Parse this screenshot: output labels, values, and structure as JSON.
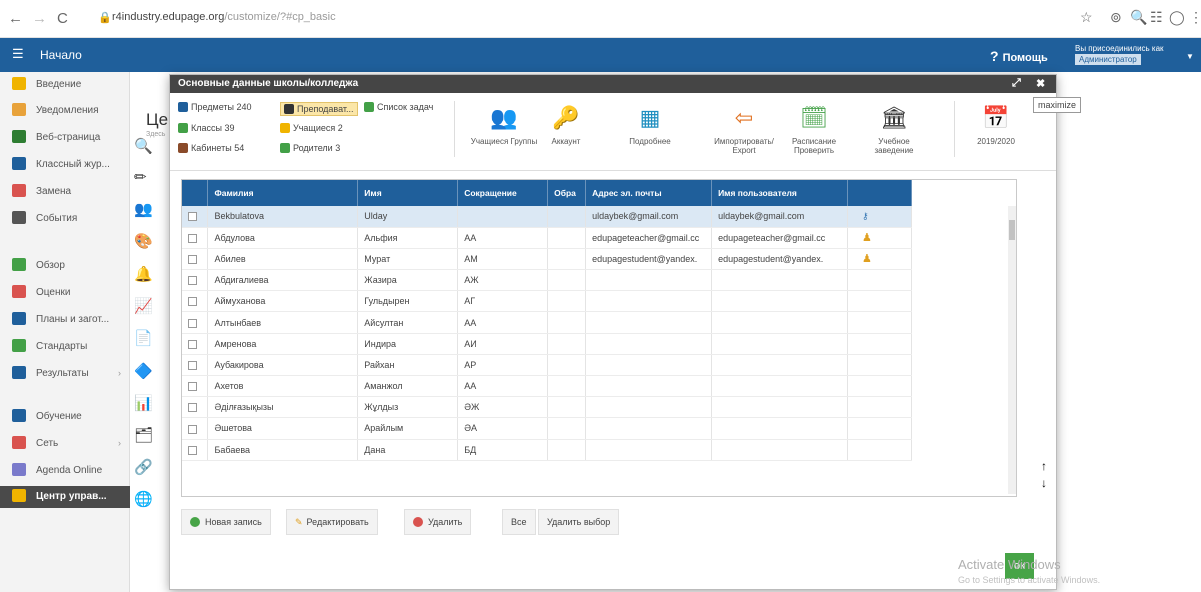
{
  "browser": {
    "url_host": "r4industry.edupage.org",
    "url_path": "/customize/?#cp_basic"
  },
  "header": {
    "home": "Начало",
    "help": "Помощь",
    "user_line": "Вы присоединились как",
    "user_role": "Администратор"
  },
  "sidebar": {
    "items": [
      {
        "label": "Введение",
        "color": "#f0b400"
      },
      {
        "label": "Уведомления",
        "color": "#e8a23a"
      },
      {
        "label": "Веб-страница",
        "color": "#2e7d32"
      },
      {
        "label": "Классный жур...",
        "color": "#1f5f9b"
      },
      {
        "label": "Замена",
        "color": "#d9534f"
      },
      {
        "label": "События",
        "color": "#555555"
      },
      {
        "label": "Обзор",
        "color": "#43a047"
      },
      {
        "label": "Оценки",
        "color": "#d9534f"
      },
      {
        "label": "Планы и загот...",
        "color": "#1f5f9b"
      },
      {
        "label": "Стандарты",
        "color": "#43a047"
      },
      {
        "label": "Результаты",
        "color": "#1f5f9b"
      },
      {
        "label": "Обучение",
        "color": "#1f5f9b"
      },
      {
        "label": "Сеть",
        "color": "#d9534f"
      },
      {
        "label": "Agenda Online",
        "color": "#7a7acb"
      },
      {
        "label": "Центр управ...",
        "color": "#f0b400"
      }
    ]
  },
  "background": {
    "title": "Цен",
    "subtitle": "Здесь"
  },
  "dialog": {
    "title": "Основные данные школы/колледжа",
    "quick_links": [
      {
        "label": "Предметы 240",
        "color": "#1f5f9b"
      },
      {
        "label": "Преподават...",
        "color": "#333333"
      },
      {
        "label": "Список задач",
        "color": "#43a047"
      },
      {
        "label": "Классы 39",
        "color": "#43a047"
      },
      {
        "label": "Учащиеся 2",
        "color": "#f0b400"
      },
      {
        "label": "Кабинеты 54",
        "color": "#8a4b2a"
      },
      {
        "label": "Родители 3",
        "color": "#43a047"
      }
    ],
    "toolbar_buttons": [
      {
        "label": "Учащиеся Группы",
        "icon": "👥"
      },
      {
        "label": "Аккаунт",
        "icon": "🔑"
      },
      {
        "label": "Подробнее",
        "icon": "▦"
      },
      {
        "label": "Импортировать/ Export",
        "icon": "⇦"
      },
      {
        "label": "Расписание Проверить",
        "icon": "🗓"
      },
      {
        "label": "Учебное заведение",
        "icon": "🏛"
      },
      {
        "label": "2019/2020",
        "icon": "📅"
      }
    ],
    "columns": [
      "Фамилия",
      "Имя",
      "Сокращение",
      "Обра",
      "Адрес эл. почты",
      "Имя пользователя"
    ],
    "rows": [
      {
        "last": "Bekbulatova",
        "first": "Ulday",
        "abbr": "",
        "email": "uldaybek@gmail.com",
        "user": "uldaybek@gmail.com",
        "icon": "key"
      },
      {
        "last": "Абдулова",
        "first": "Альфия",
        "abbr": "АА",
        "email": "edupageteacher@gmail.cc",
        "user": "edupageteacher@gmail.cc",
        "icon": "user"
      },
      {
        "last": "Абилев",
        "first": "Мурат",
        "abbr": "АМ",
        "email": "edupagestudent@yandex.",
        "user": "edupagestudent@yandex.",
        "icon": "user"
      },
      {
        "last": "Абдигалиева",
        "first": "Жазира",
        "abbr": "АЖ",
        "email": "",
        "user": "",
        "icon": ""
      },
      {
        "last": "Аймуханова",
        "first": "Гульдырен",
        "abbr": "АГ",
        "email": "",
        "user": "",
        "icon": ""
      },
      {
        "last": "Алтынбаев",
        "first": "Айсултан",
        "abbr": "АА",
        "email": "",
        "user": "",
        "icon": ""
      },
      {
        "last": "Амренова",
        "first": "Индира",
        "abbr": "АИ",
        "email": "",
        "user": "",
        "icon": ""
      },
      {
        "last": "Аубакирова",
        "first": "Райхан",
        "abbr": "АР",
        "email": "",
        "user": "",
        "icon": ""
      },
      {
        "last": "Ахетов",
        "first": "Аманжол",
        "abbr": "АА",
        "email": "",
        "user": "",
        "icon": ""
      },
      {
        "last": "Әділғазықызы",
        "first": "Жұлдыз",
        "abbr": "ӘЖ",
        "email": "",
        "user": "",
        "icon": ""
      },
      {
        "last": "Әшетова",
        "first": "Арайлым",
        "abbr": "ӘА",
        "email": "",
        "user": "",
        "icon": ""
      },
      {
        "last": "Бабаева",
        "first": "Дана",
        "abbr": "БД",
        "email": "",
        "user": "",
        "icon": ""
      }
    ],
    "buttons": {
      "new": "Новая запись",
      "edit": "Редактировать",
      "delete": "Удалить",
      "all": "Все",
      "clear": "Удалить выбор",
      "ok": "ок"
    }
  },
  "tooltip": "maximize",
  "watermark": {
    "line1": "Activate Windows",
    "line2": "Go to Settings to activate Windows."
  }
}
